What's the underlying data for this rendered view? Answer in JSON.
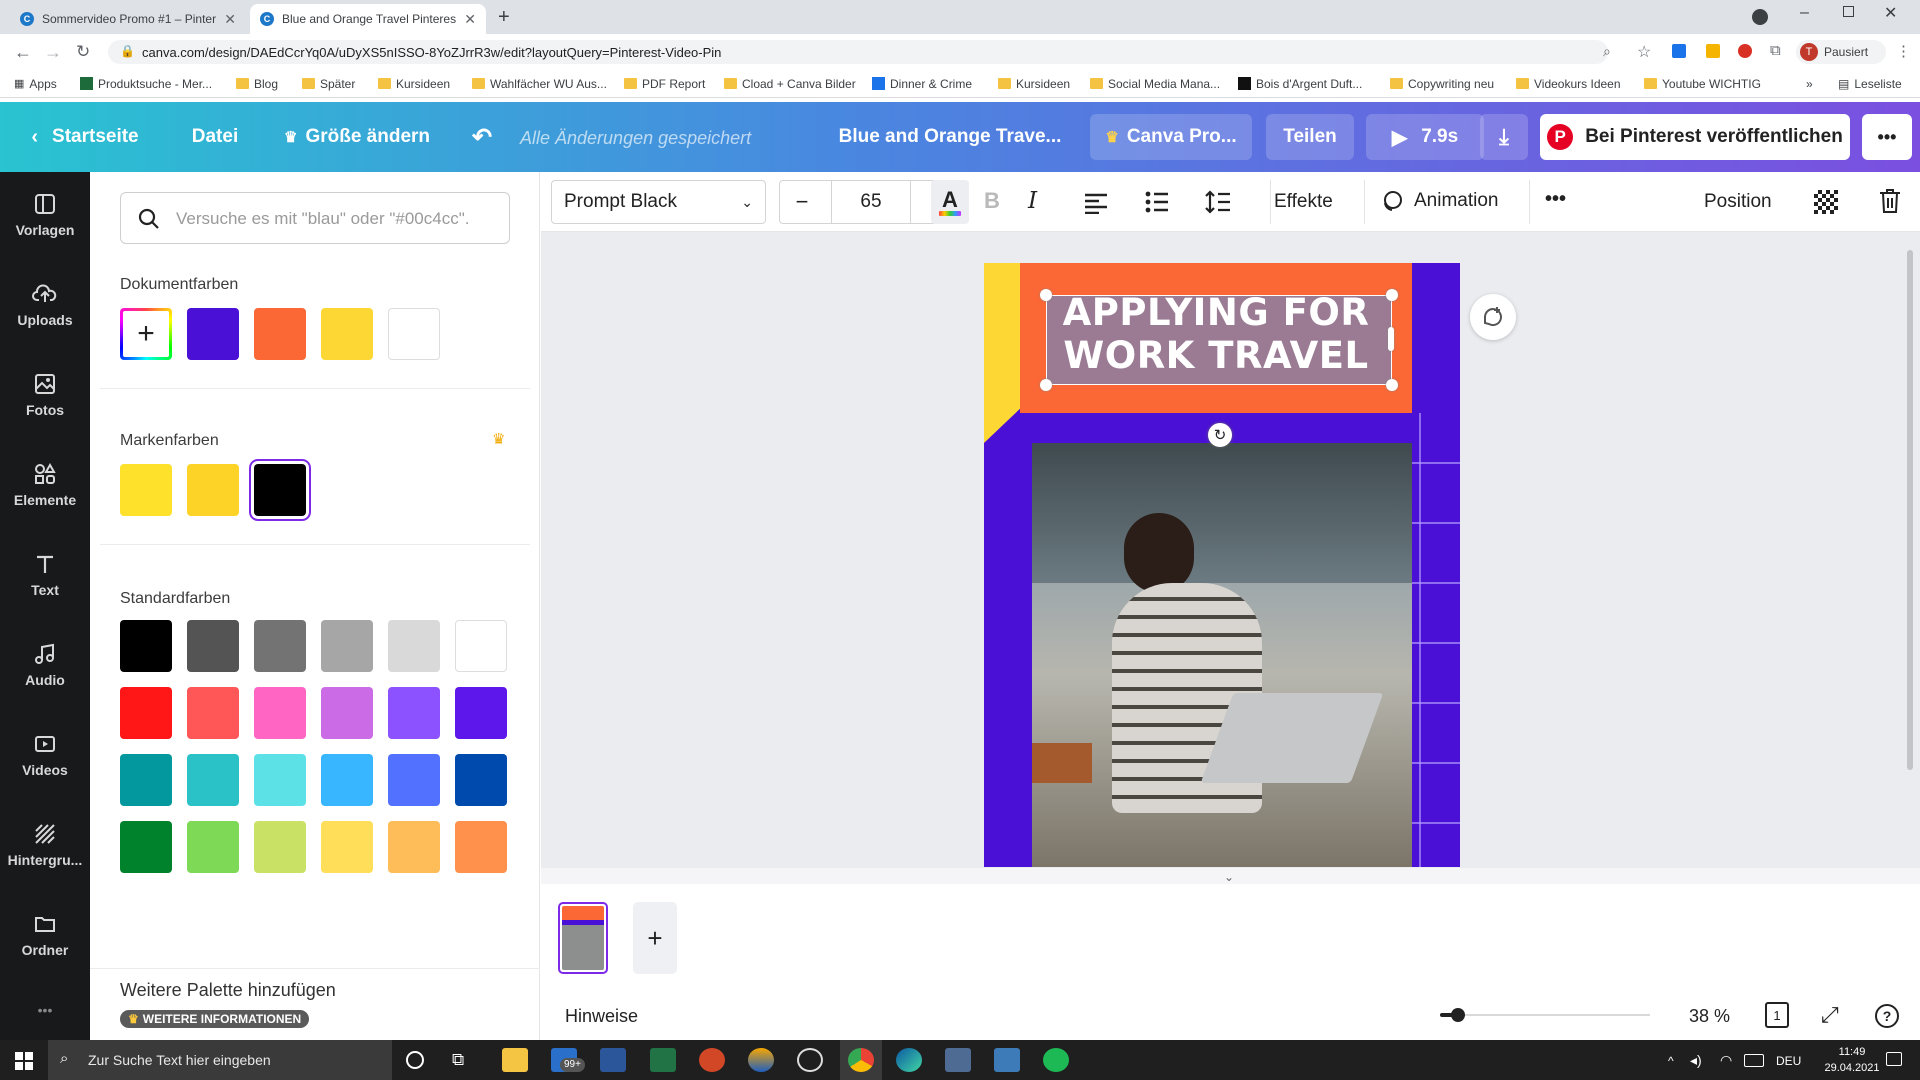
{
  "browser": {
    "tabs": [
      {
        "title": "Sommervideo Promo #1 – Pinter"
      },
      {
        "title": "Blue and Orange Travel Pinterest"
      }
    ],
    "url": "canva.com/design/DAEdCcrYq0A/uDyXS5nISSO-8YoZJrrR3w/edit?layoutQuery=Pinterest-Video-Pin",
    "profile_status": "Pausiert",
    "bookmarks": [
      "Apps",
      "Produktsuche - Mer...",
      "Blog",
      "Später",
      "Kursideen",
      "Wahlfächer WU Aus...",
      "PDF Report",
      "Cload + Canva Bilder",
      "Dinner & Crime",
      "Kursideen",
      "Social Media Mana...",
      "Bois d'Argent Duft...",
      "Copywriting neu",
      "Videokurs Ideen",
      "Youtube WICHTIG"
    ],
    "reading_list": "Leseliste",
    "more_bookmarks": "»"
  },
  "header": {
    "home": "Startseite",
    "file": "Datei",
    "resize": "Größe ändern",
    "saved": "Alle Änderungen gespeichert",
    "design_title": "Blue and Orange Trave...",
    "canva_pro": "Canva Pro...",
    "share": "Teilen",
    "duration": "7.9s",
    "pinterest": "Bei Pinterest veröffentlichen",
    "more": "•••"
  },
  "sidebar": {
    "items": [
      {
        "label": "Vorlagen",
        "icon": "templates-icon"
      },
      {
        "label": "Uploads",
        "icon": "upload-icon"
      },
      {
        "label": "Fotos",
        "icon": "photos-icon"
      },
      {
        "label": "Elemente",
        "icon": "elements-icon"
      },
      {
        "label": "Text",
        "icon": "text-icon"
      },
      {
        "label": "Audio",
        "icon": "audio-icon"
      },
      {
        "label": "Videos",
        "icon": "videos-icon"
      },
      {
        "label": "Hintergru...",
        "icon": "background-icon"
      },
      {
        "label": "Ordner",
        "icon": "folder-icon"
      }
    ],
    "more": "•••"
  },
  "panel": {
    "search_placeholder": "Versuche es mit \"blau\" oder \"#00c4cc\".",
    "document_colors_title": "Dokumentfarben",
    "document_colors": [
      "#4b10d6",
      "#fb6735",
      "#fdd835",
      "#ffffff"
    ],
    "brand_colors_title": "Markenfarben",
    "brand_colors": [
      "#fde12b",
      "#fdd328",
      "#000000"
    ],
    "standard_colors_title": "Standardfarben",
    "standard_colors": [
      [
        "#000000",
        "#545454",
        "#737373",
        "#a6a6a6",
        "#d9d9d9",
        "#ffffff"
      ],
      [
        "#ff1616",
        "#ff5757",
        "#ff66c4",
        "#cb6ce6",
        "#8c52ff",
        "#5e17eb"
      ],
      [
        "#03989e",
        "#2ac1c7",
        "#5ce1e6",
        "#38b6ff",
        "#5271ff",
        "#004aad"
      ],
      [
        "#00812c",
        "#7ed957",
        "#c9e265",
        "#ffde59",
        "#ffbd59",
        "#ff914d"
      ]
    ],
    "add_palette": "Weitere Palette hinzufügen",
    "more_info": "WEITERE INFORMATIONEN"
  },
  "toolbar": {
    "font": "Prompt Black",
    "font_size": "65",
    "minus": "−",
    "plus": "+",
    "bold": "B",
    "italic": "I",
    "effects": "Effekte",
    "animation": "Animation",
    "more": "•••",
    "position": "Position"
  },
  "design": {
    "headline_line1": "APPLYING FOR",
    "headline_line2": "WORK TRAVEL",
    "colors": {
      "purple": "#4b10d6",
      "orange": "#fb6735",
      "yellow": "#fdd835"
    }
  },
  "bottom": {
    "notes": "Hinweise",
    "zoom": "38 %",
    "page_count": "1",
    "help": "?",
    "zoom_level": 0.05
  },
  "taskbar": {
    "search_placeholder": "Zur Suche Text hier eingeben",
    "mail_badge": "99+",
    "language": "DEU",
    "time": "11:49",
    "date": "29.04.2021"
  }
}
